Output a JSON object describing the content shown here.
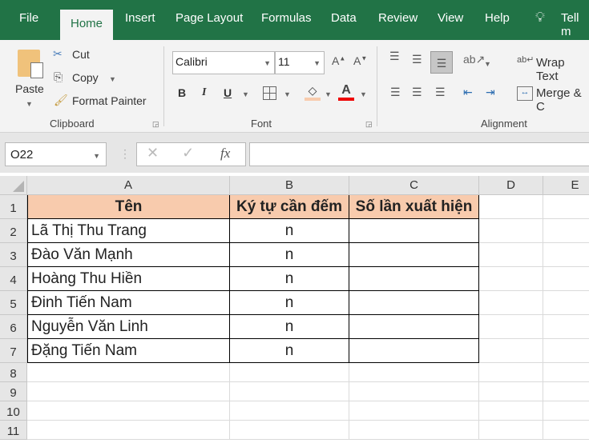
{
  "tabs": [
    "File",
    "Home",
    "Insert",
    "Page Layout",
    "Formulas",
    "Data",
    "Review",
    "View",
    "Help",
    "Tell m"
  ],
  "clipboard": {
    "paste": "Paste",
    "cut": "Cut",
    "copy": "Copy",
    "format_painter": "Format Painter",
    "group": "Clipboard"
  },
  "font": {
    "name": "Calibri",
    "size": "11",
    "bold": "B",
    "italic": "I",
    "underline": "U",
    "color_glyph": "A",
    "group": "Font"
  },
  "alignment": {
    "wrap": "Wrap Text",
    "merge": "Merge & C",
    "group": "Alignment"
  },
  "formula_bar": {
    "name_box": "O22",
    "fx": "fx",
    "value": ""
  },
  "columns": [
    "A",
    "B",
    "C",
    "D",
    "E"
  ],
  "rows": [
    "1",
    "2",
    "3",
    "4",
    "5",
    "6",
    "7",
    "8",
    "9",
    "10",
    "11"
  ],
  "table": {
    "headers": [
      "Tên",
      "Ký tự cần đếm",
      "Số lần xuất hiện"
    ],
    "data": [
      [
        "Lã Thị Thu Trang",
        "n",
        ""
      ],
      [
        "Đào Văn Mạnh",
        "n",
        ""
      ],
      [
        "Hoàng Thu Hiền",
        "n",
        ""
      ],
      [
        "Đinh Tiến Nam",
        "n",
        ""
      ],
      [
        "Nguyễn Văn Linh",
        "n",
        ""
      ],
      [
        "Đặng Tiến Nam",
        "n",
        ""
      ]
    ]
  },
  "colors": {
    "accent": "#217346",
    "header_fill": "#f8cbad"
  }
}
